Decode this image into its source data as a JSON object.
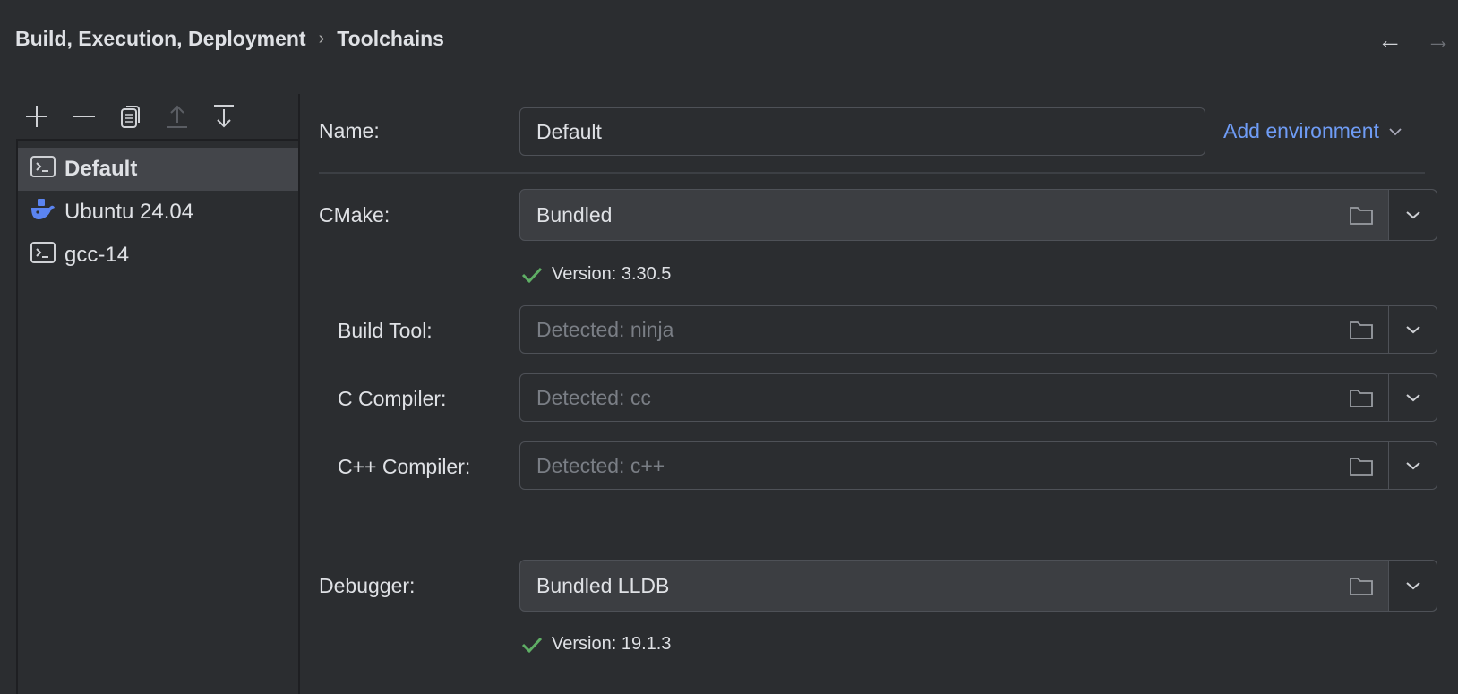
{
  "breadcrumb": {
    "parent": "Build, Execution, Deployment",
    "separator": "›",
    "current": "Toolchains"
  },
  "nav": {
    "back": "←",
    "forward": "→"
  },
  "toolchains": [
    {
      "label": "Default",
      "icon": "terminal-icon",
      "selected": true
    },
    {
      "label": "Ubuntu 24.04",
      "icon": "docker-icon",
      "selected": false
    },
    {
      "label": "gcc-14",
      "icon": "terminal-icon",
      "selected": false
    }
  ],
  "form": {
    "name_label": "Name:",
    "name_value": "Default",
    "add_env": "Add environment",
    "cmake_label": "CMake:",
    "cmake_value": "Bundled",
    "cmake_version": "Version: 3.30.5",
    "build_tool_label": "Build Tool:",
    "build_tool_placeholder": "Detected: ninja",
    "c_label": "C Compiler:",
    "c_placeholder": "Detected: cc",
    "cpp_label": "C++ Compiler:",
    "cpp_placeholder": "Detected: c++",
    "debugger_label": "Debugger:",
    "debugger_value": "Bundled LLDB",
    "debugger_version": "Version: 19.1.3"
  },
  "colors": {
    "accent": "#6f9cf5",
    "success": "#5fae65",
    "docker": "#5b84f0"
  }
}
